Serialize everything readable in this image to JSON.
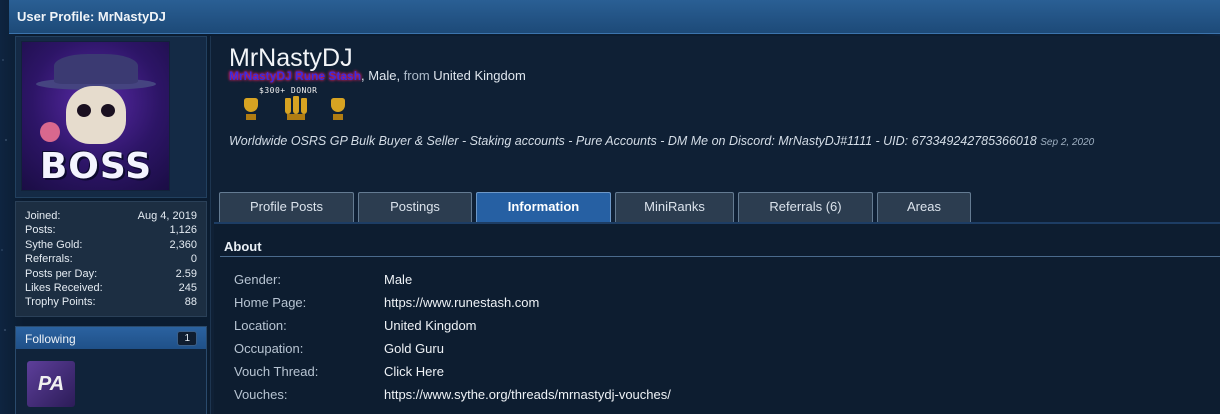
{
  "page": {
    "title": "User Profile: MrNastyDJ"
  },
  "profile": {
    "username": "MrNastyDJ",
    "user_title": "MrNastyDJ Rune Stash",
    "gender_sep": ", Male, ",
    "from_word": "from",
    "location": "United Kingdom",
    "donor_badge": "$300+ DONOR",
    "status": "Worldwide OSRS GP Bulk Buyer & Seller - Staking accounts - Pure Accounts - DM Me on Discord: MrNastyDJ#1111 - UID: 673349242785366018",
    "status_date": "Sep 2, 2020",
    "avatar_text": "BOSS"
  },
  "stats": [
    {
      "label": "Joined:",
      "value": "Aug 4, 2019"
    },
    {
      "label": "Posts:",
      "value": "1,126"
    },
    {
      "label": "Sythe Gold:",
      "value": "2,360"
    },
    {
      "label": "Referrals:",
      "value": "0"
    },
    {
      "label": "Posts per Day:",
      "value": "2.59"
    },
    {
      "label": "Likes Received:",
      "value": "245"
    },
    {
      "label": "Trophy Points:",
      "value": "88"
    }
  ],
  "following": {
    "label": "Following",
    "count": "1",
    "avatar_text": "PA"
  },
  "tabs": [
    {
      "label": "Profile Posts"
    },
    {
      "label": "Postings"
    },
    {
      "label": "Information",
      "active": true
    },
    {
      "label": "MiniRanks"
    },
    {
      "label": "Referrals (6)"
    },
    {
      "label": "Areas"
    }
  ],
  "about": {
    "title": "About",
    "rows": [
      {
        "label": "Gender:",
        "value": "Male"
      },
      {
        "label": "Home Page:",
        "value": "https://www.runestash.com"
      },
      {
        "label": "Location:",
        "value": "United Kingdom"
      },
      {
        "label": "Occupation:",
        "value": "Gold Guru"
      },
      {
        "label": "Vouch Thread:",
        "value": "Click Here"
      },
      {
        "label": "Vouches:",
        "value": "https://www.sythe.org/threads/mrnastydj-vouches/"
      }
    ]
  },
  "colors": {
    "accent": "#2660a3",
    "title_bar": "#1d4a78",
    "user_title": "#3b2be0"
  },
  "icons": [
    "trophy-icon",
    "trophy-icon",
    "trophy-icon"
  ]
}
